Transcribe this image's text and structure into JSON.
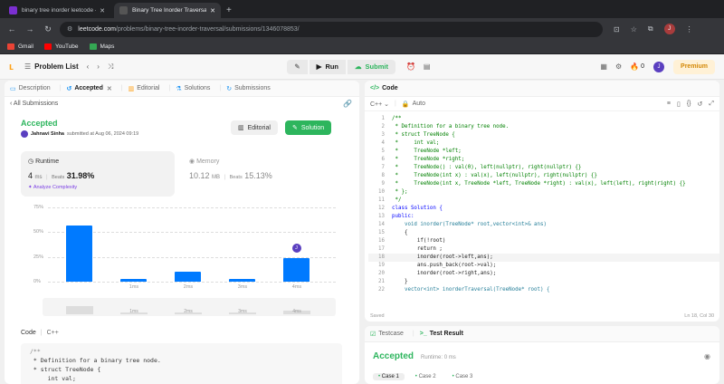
{
  "browser": {
    "tabs": [
      {
        "title": "binary tree inorder leetcode - Y",
        "fav_color": "#7b2fd1"
      },
      {
        "title": "Binary Tree Inorder Traversal - Le",
        "fav_color": "#333333"
      }
    ],
    "url_domain": "leetcode.com",
    "url_path": "/problems/binary-tree-inorder-traversal/submissions/1346078853/",
    "bookmarks": [
      {
        "label": "Gmail",
        "color": "#ea4335"
      },
      {
        "label": "YouTube",
        "color": "#ff0000"
      },
      {
        "label": "Maps",
        "color": "#34a853"
      }
    ]
  },
  "lc": {
    "problem_list": "Problem List",
    "run": "Run",
    "submit": "Submit",
    "streak": "0",
    "avatar": "J",
    "premium": "Premium"
  },
  "left": {
    "tabs": [
      "Description",
      "Accepted",
      "Editorial",
      "Solutions",
      "Submissions"
    ],
    "all_submissions": "All Submissions",
    "status": "Accepted",
    "author": "Jahnavi Sinha",
    "submitted": "submitted at Aug 06, 2024 09:19",
    "editorial_btn": "Editorial",
    "solution_btn": "Solution",
    "runtime": {
      "label": "Runtime",
      "value": "4",
      "unit": "ms",
      "beats_label": "Beats",
      "beats": "31.98%",
      "analyze": "Analyze Complexity"
    },
    "memory": {
      "label": "Memory",
      "value": "10.12",
      "unit": "MB",
      "beats_label": "Beats",
      "beats": "15.13%"
    },
    "code_label": "Code",
    "lang": "C++",
    "preview": [
      "/**",
      " * Definition for a binary tree node.",
      " * struct TreeNode {",
      "     int val;"
    ]
  },
  "chart_data": {
    "type": "bar",
    "y_ticks": [
      "75%",
      "50%",
      "25%",
      "0%"
    ],
    "ylim": [
      0,
      75
    ],
    "bars": [
      {
        "value": 57,
        "label": ""
      },
      {
        "value": 3,
        "label": "1ms"
      },
      {
        "value": 10,
        "label": "2ms"
      },
      {
        "value": 3,
        "label": "3ms"
      },
      {
        "value": 24,
        "label": "4ms"
      }
    ],
    "nav_labels": [
      "1ms",
      "2ms",
      "3ms",
      "4ms"
    ],
    "marker": "J",
    "marker_index": 4
  },
  "right": {
    "code_tab": "Code",
    "lang": "C++",
    "auto": "Auto",
    "saved": "Saved",
    "cursor": "Ln 18, Col 30",
    "testcase": "Testcase",
    "test_result": "Test Result",
    "result_status": "Accepted",
    "runtime": "Runtime: 0 ms",
    "cases": [
      "Case 1",
      "Case 2",
      "Case 3"
    ],
    "code": [
      {
        "n": "1",
        "t": "/**"
      },
      {
        "n": "2",
        "t": " * Definition for a binary tree node."
      },
      {
        "n": "3",
        "t": " * struct TreeNode {"
      },
      {
        "n": "4",
        "t": " *     int val;"
      },
      {
        "n": "5",
        "t": " *     TreeNode *left;"
      },
      {
        "n": "6",
        "t": " *     TreeNode *right;"
      },
      {
        "n": "7",
        "t": " *     TreeNode() : val(0), left(nullptr), right(nullptr) {}"
      },
      {
        "n": "8",
        "t": " *     TreeNode(int x) : val(x), left(nullptr), right(nullptr) {}"
      },
      {
        "n": "9",
        "t": " *     TreeNode(int x, TreeNode *left, TreeNode *right) : val(x), left(left), right(right) {}"
      },
      {
        "n": "10",
        "t": " * };"
      },
      {
        "n": "11",
        "t": " */"
      },
      {
        "n": "12",
        "t": "class Solution {"
      },
      {
        "n": "13",
        "t": "public:"
      },
      {
        "n": "14",
        "t": "    void inorder(TreeNode* root,vector<int>& ans)"
      },
      {
        "n": "15",
        "t": "    {"
      },
      {
        "n": "16",
        "t": "        if(!root)"
      },
      {
        "n": "17",
        "t": "        return ;"
      },
      {
        "n": "18",
        "t": "        inorder(root->left,ans);"
      },
      {
        "n": "19",
        "t": "        ans.push_back(root->val);"
      },
      {
        "n": "20",
        "t": "        inorder(root->right,ans);"
      },
      {
        "n": "21",
        "t": "    }"
      },
      {
        "n": "22",
        "t": "    vector<int> inorderTraversal(TreeNode* root) {"
      }
    ]
  }
}
